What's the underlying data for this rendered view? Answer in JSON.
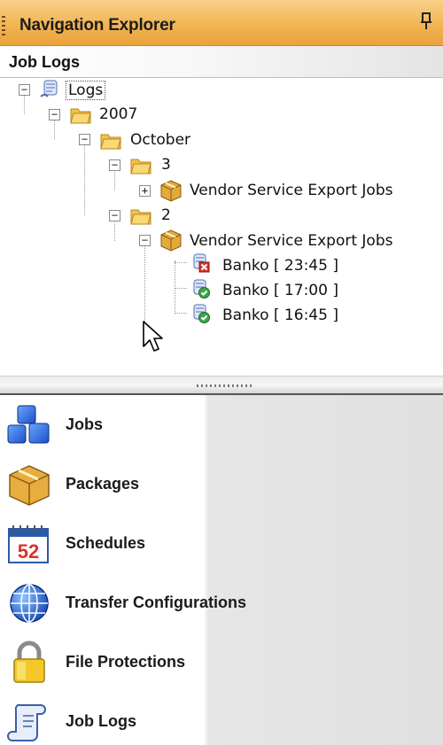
{
  "panel": {
    "title": "Navigation Explorer",
    "pin_glyph": "☉"
  },
  "section": {
    "label": "Job Logs"
  },
  "tree": {
    "root": {
      "label": "Logs",
      "icon": "logs-icon",
      "expander": "−"
    },
    "year": {
      "label": "2007",
      "icon": "folder-icon",
      "expander": "−"
    },
    "month": {
      "label": "October",
      "icon": "folder-icon",
      "expander": "−"
    },
    "day3": {
      "label": "3",
      "icon": "folder-icon",
      "expander": "−"
    },
    "day3_job": {
      "label": "Vendor Service Export Jobs",
      "icon": "package-icon",
      "expander": "+"
    },
    "day2": {
      "label": "2",
      "icon": "folder-icon",
      "expander": "−"
    },
    "day2_job": {
      "label": "Vendor Service Export Jobs",
      "icon": "package-icon",
      "expander": "−"
    },
    "entries": [
      {
        "label": "Banko  [ 23:45 ]",
        "status": "failed",
        "icon": "log-error-icon"
      },
      {
        "label": "Banko  [ 17:00 ]",
        "status": "success",
        "icon": "log-success-icon"
      },
      {
        "label": "Banko  [ 16:45 ]",
        "status": "success",
        "icon": "log-success-icon"
      }
    ]
  },
  "nav": [
    {
      "label": "Jobs",
      "icon": "jobs-cubes-icon"
    },
    {
      "label": "Packages",
      "icon": "package-icon"
    },
    {
      "label": "Schedules",
      "icon": "calendar-icon",
      "icon_text": "52"
    },
    {
      "label": "Transfer Configurations",
      "icon": "globe-icon"
    },
    {
      "label": "File Protections",
      "icon": "padlock-icon"
    },
    {
      "label": "Job Logs",
      "icon": "scroll-icon"
    }
  ],
  "colors": {
    "title_bar": "#f1b553",
    "error": "#d8342b",
    "success": "#3aa64a",
    "folder": "#f3c14d"
  }
}
